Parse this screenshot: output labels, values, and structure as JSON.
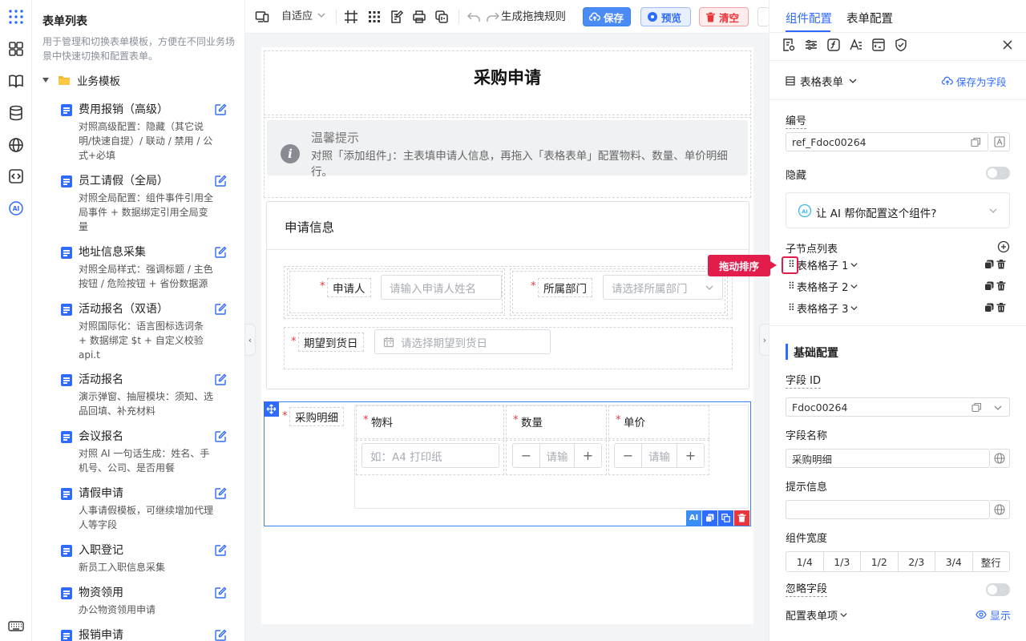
{
  "toolbar": {
    "layout_mode": "自适应",
    "generate_rule": "生成拖拽规则",
    "save": "保存",
    "preview": "预览",
    "clear": "清空"
  },
  "templates": {
    "title": "表单列表",
    "description": "用于管理和切换表单模板，方便在不同业务场景中快速切换和配置表单。",
    "group": "业务模板",
    "items": [
      {
        "name": "费用报销（高级）",
        "desc": "对照高级配置：隐藏（其它说明/快速自提）/ 联动 / 禁用 / 公式+必填"
      },
      {
        "name": "员工请假（全局）",
        "desc": "对照全局配置：组件事件引用全局事件 + 数据绑定引用全局变量"
      },
      {
        "name": "地址信息采集",
        "desc": "对照全局样式：强调标题 / 主色按钮 / 危险按钮 + 省份数据源"
      },
      {
        "name": "活动报名（双语）",
        "desc": "对照国际化：语言图标选词条 + 数据绑定 $t + 自定义校验 api.t"
      },
      {
        "name": "活动报名",
        "desc": "演示弹窗、抽屉模块：须知、选品回填、补充材料"
      },
      {
        "name": "会议报名",
        "desc": "对照 AI 一句话生成：姓名、手机号、公司、是否用餐"
      },
      {
        "name": "请假申请",
        "desc": "人事请假模板，可继续增加代理人等字段"
      },
      {
        "name": "入职登记",
        "desc": "新员工入职信息采集"
      },
      {
        "name": "物资领用",
        "desc": "办公物资领用申请"
      },
      {
        "name": "报销申请",
        "desc": ""
      }
    ]
  },
  "form": {
    "title": "采购申请",
    "notice_title": "温馨提示",
    "notice_text": "对照「添加组件」：主表填申请人信息，再拖入「表格表单」配置物料、数量、单价明细行。",
    "section_title": "申请信息",
    "applicant_label": "申请人",
    "applicant_placeholder": "请输入申请人姓名",
    "dept_label": "所属部门",
    "dept_placeholder": "请选择所属部门",
    "date_label": "期望到货日",
    "date_placeholder": "请选择期望到货日",
    "table_label": "采购明细",
    "columns": [
      "物料",
      "数量",
      "单价"
    ],
    "material_placeholder": "如：A4 打印纸",
    "qty_placeholder": "请输",
    "price_placeholder": "请输",
    "minus": "−",
    "plus": "+"
  },
  "props": {
    "tab_component": "组件配置",
    "tab_form": "表单配置",
    "component_type": "表格表单",
    "save_as_field": "保存为字段",
    "code_label": "编号",
    "code_value": "ref_Fdoc00264",
    "hidden_label": "隐藏",
    "ai_prompt": "让 AI 帮你配置这个组件?",
    "children_label": "子节点列表",
    "children": [
      "表格格子 1",
      "表格格子 2",
      "表格格子 3"
    ],
    "drag_sort_tip": "拖动排序",
    "basic_section": "基础配置",
    "field_id_label": "字段 ID",
    "field_id_value": "Fdoc00264",
    "field_name_label": "字段名称",
    "field_name_value": "采购明细",
    "hint_label": "提示信息",
    "hint_value": "",
    "width_label": "组件宽度",
    "widths": [
      "1/4",
      "1/3",
      "1/2",
      "2/3",
      "3/4",
      "整行"
    ],
    "ignore_label": "忽略字段",
    "config_items_label": "配置表单项",
    "show_label": "显示"
  }
}
